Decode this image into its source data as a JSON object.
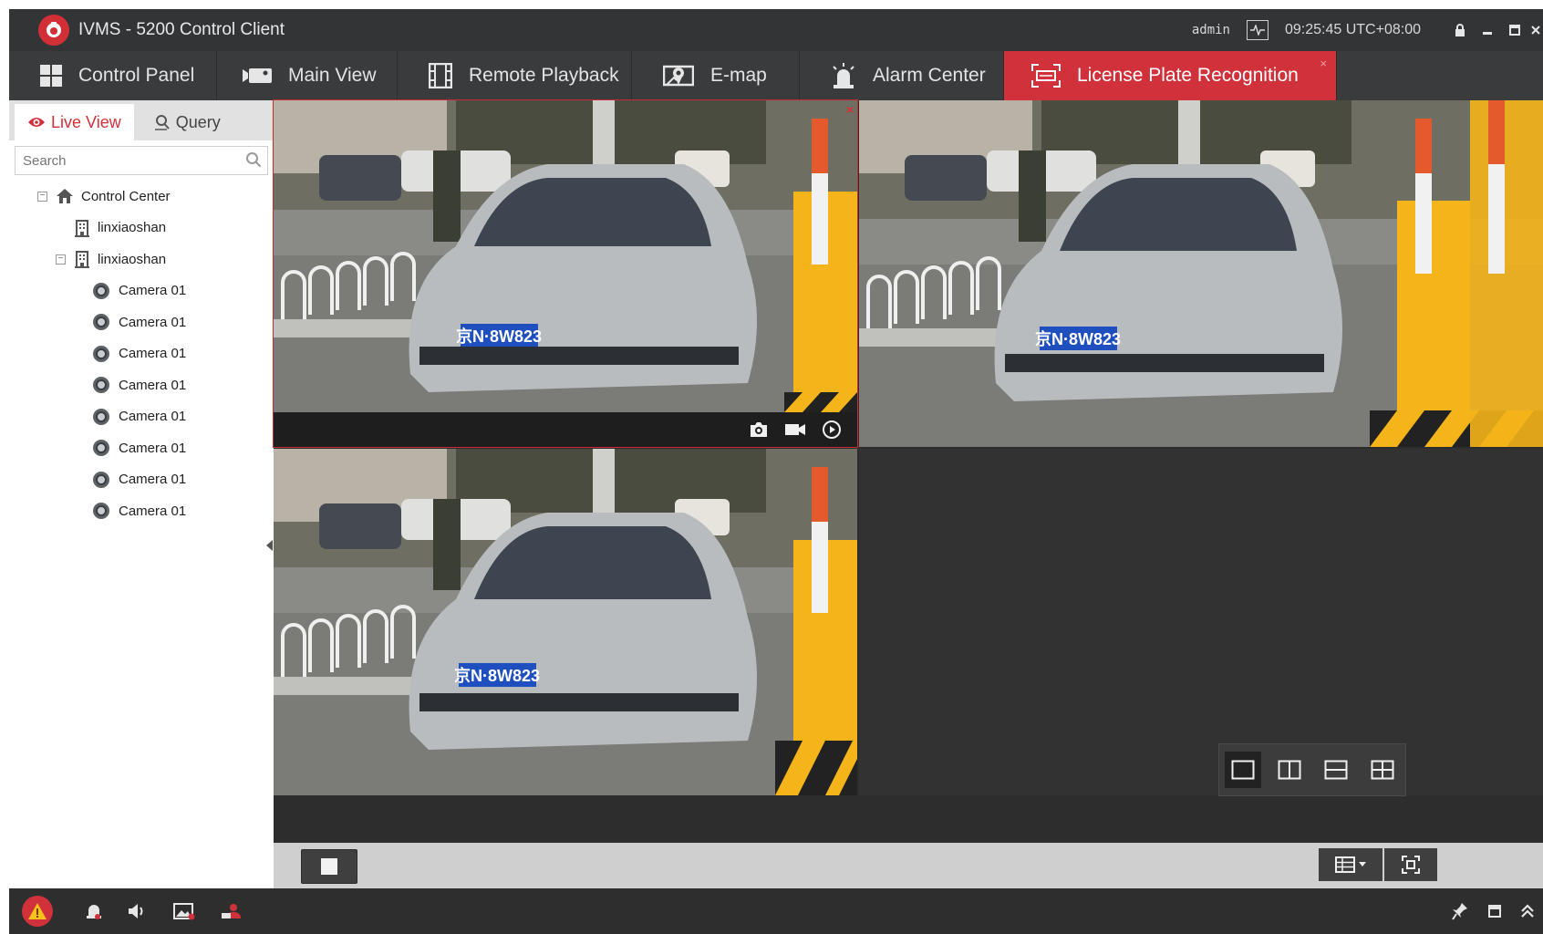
{
  "window": {
    "title": "IVMS - 5200 Control Client",
    "user": "admin",
    "clock": "09:25:45 UTC+08:00"
  },
  "nav": {
    "tabs": [
      {
        "label": "Control Panel",
        "icon": "grid-icon"
      },
      {
        "label": "Main View",
        "icon": "video-camera-icon"
      },
      {
        "label": "Remote Playback",
        "icon": "film-icon"
      },
      {
        "label": "E-map",
        "icon": "map-icon"
      },
      {
        "label": "Alarm Center",
        "icon": "alarm-light-icon"
      },
      {
        "label": "License Plate Recognition",
        "icon": "plate-scan-icon",
        "active": true
      }
    ]
  },
  "left_panel": {
    "tabs": [
      {
        "label": "Live View",
        "active": true
      },
      {
        "label": "Query"
      }
    ],
    "search_placeholder": "Search",
    "tree": {
      "root": "Control Center",
      "groups": [
        "linxiaoshan",
        "linxiaoshan"
      ],
      "cameras": [
        "Camera 01",
        "Camera 01",
        "Camera 01",
        "Camera 01",
        "Camera 01",
        "Camera 01",
        "Camera 01",
        "Camera 01"
      ]
    }
  },
  "video": {
    "plate_text": "京N·8W823",
    "pane_close": "×",
    "active_tab_close": "×"
  },
  "colors": {
    "accent": "#d0313a",
    "titlebar": "#333436",
    "navbar": "#3a3b3d"
  }
}
